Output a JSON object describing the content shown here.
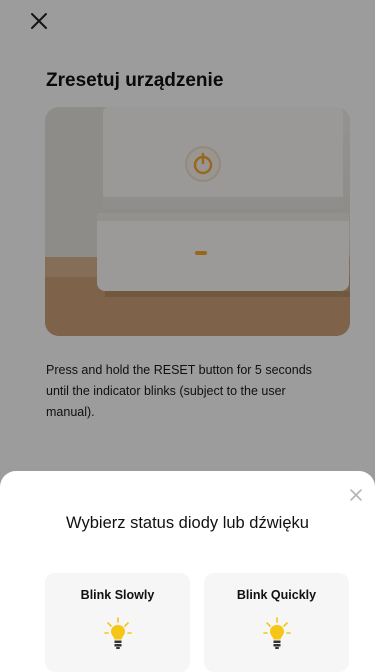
{
  "header": {
    "close_icon": "close-icon"
  },
  "page": {
    "title": "Zresetuj urządzenie",
    "description": "Press and hold the RESET button for 5 seconds until the indicator blinks (subject to the user manual)."
  },
  "sheet": {
    "title": "Wybierz status diody lub dźwięku",
    "close_icon": "close-icon",
    "options": [
      {
        "label": "Blink Slowly",
        "icon": "bulb-icon"
      },
      {
        "label": "Blink Quickly",
        "icon": "bulb-icon"
      }
    ]
  },
  "colors": {
    "bulb": "#f5c518",
    "indicator": "#f0a030"
  }
}
